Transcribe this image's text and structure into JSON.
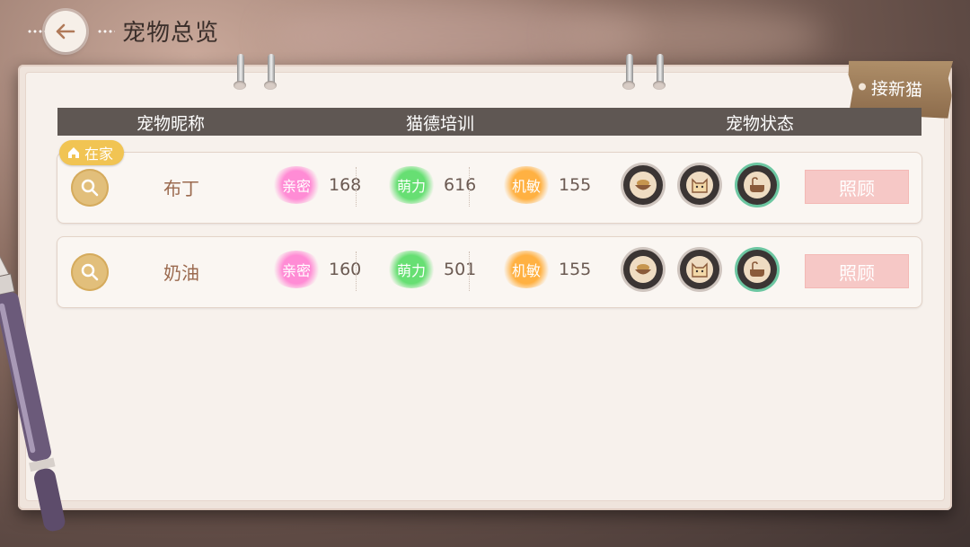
{
  "header": {
    "title": "宠物总览",
    "back_icon": "back-arrow-icon"
  },
  "new_cat_button": {
    "label": "接新猫"
  },
  "table": {
    "columns": [
      "宠物昵称",
      "猫德培训",
      "宠物状态"
    ],
    "home_badge": "在家",
    "rows": [
      {
        "name": "布丁",
        "stats": [
          {
            "label": "亲密",
            "value": "168",
            "color": "#ff8fd1"
          },
          {
            "label": "萌力",
            "value": "616",
            "color": "#6fdc7a"
          },
          {
            "label": "机敏",
            "value": "155",
            "color": "#ffb24d"
          }
        ],
        "status_icons": [
          "food-bowl-icon",
          "cat-face-icon",
          "bath-icon"
        ],
        "care_label": "照顾"
      },
      {
        "name": "奶油",
        "stats": [
          {
            "label": "亲密",
            "value": "160",
            "color": "#ff8fd1"
          },
          {
            "label": "萌力",
            "value": "501",
            "color": "#6fdc7a"
          },
          {
            "label": "机敏",
            "value": "155",
            "color": "#ffb24d"
          }
        ],
        "status_icons": [
          "food-bowl-icon",
          "cat-face-icon",
          "bath-icon"
        ],
        "care_label": "照顾"
      }
    ]
  },
  "colors": {
    "header_bar": "#5f5753",
    "badge": "#f1c453",
    "care_button": "#f6c8c6"
  }
}
